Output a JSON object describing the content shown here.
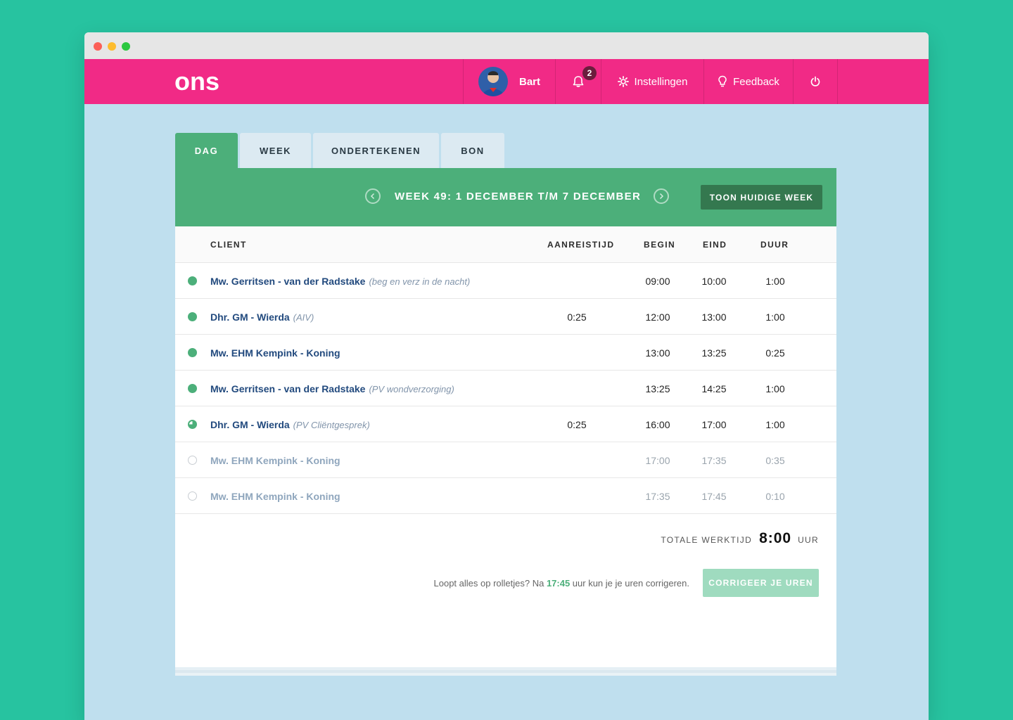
{
  "app": {
    "logo_text": "ons"
  },
  "nav": {
    "user_name": "Bart",
    "notification_count": "2",
    "settings_label": "Instellingen",
    "feedback_label": "Feedback"
  },
  "tabs": [
    {
      "label": "DAG",
      "active": true
    },
    {
      "label": "WEEK",
      "active": false
    },
    {
      "label": "ONDERTEKENEN",
      "active": false
    },
    {
      "label": "BON",
      "active": false
    }
  ],
  "week": {
    "label": "WEEK 49: 1 DECEMBER T/M 7 DECEMBER",
    "current_week_button": "TOON HUIDIGE WEEK"
  },
  "table": {
    "headers": {
      "client": "CLIENT",
      "aanreistijd": "AANREISTIJD",
      "begin": "BEGIN",
      "eind": "EIND",
      "duur": "DUUR"
    },
    "rows": [
      {
        "status": "done",
        "client": "Mw. Gerritsen - van der Radstake",
        "note": "(beg en verz in de nacht)",
        "aanreistijd": "",
        "begin": "09:00",
        "eind": "10:00",
        "duur": "1:00"
      },
      {
        "status": "done",
        "client": "Dhr. GM - Wierda",
        "note": "(AIV)",
        "aanreistijd": "0:25",
        "begin": "12:00",
        "eind": "13:00",
        "duur": "1:00"
      },
      {
        "status": "done",
        "client": "Mw. EHM Kempink - Koning",
        "note": "",
        "aanreistijd": "",
        "begin": "13:00",
        "eind": "13:25",
        "duur": "0:25"
      },
      {
        "status": "done",
        "client": "Mw. Gerritsen - van der Radstake",
        "note": "(PV wondverzorging)",
        "aanreistijd": "",
        "begin": "13:25",
        "eind": "14:25",
        "duur": "1:00"
      },
      {
        "status": "partial",
        "client": "Dhr. GM - Wierda",
        "note": "(PV Cliëntgesprek)",
        "aanreistijd": "0:25",
        "begin": "16:00",
        "eind": "17:00",
        "duur": "1:00"
      },
      {
        "status": "open",
        "client": "Mw. EHM Kempink - Koning",
        "note": "",
        "aanreistijd": "",
        "begin": "17:00",
        "eind": "17:35",
        "duur": "0:35"
      },
      {
        "status": "open",
        "client": "Mw. EHM Kempink - Koning",
        "note": "",
        "aanreistijd": "",
        "begin": "17:35",
        "eind": "17:45",
        "duur": "0:10"
      }
    ]
  },
  "total": {
    "label": "TOTALE WERKTIJD",
    "value": "8:00",
    "unit": "UUR"
  },
  "correct": {
    "message_before": "Loopt alles op rolletjes? Na ",
    "time": "17:45",
    "message_after": " uur kun je je uren corrigeren.",
    "button_label": "CORRIGEER JE UREN"
  },
  "colors": {
    "background": "#27c3a0",
    "topbar": "#f12a86",
    "accent_green": "#4caf7a",
    "content_bg": "#bfdfee",
    "client_link": "#224a7e"
  }
}
